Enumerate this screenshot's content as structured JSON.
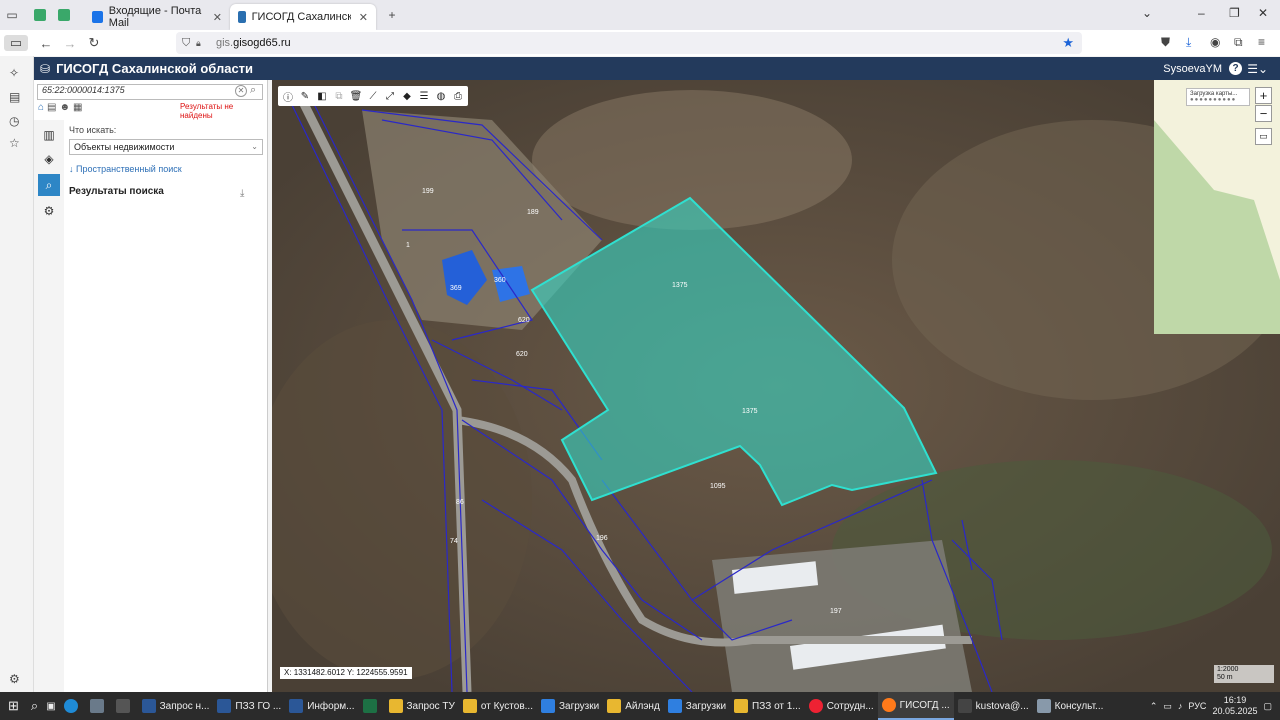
{
  "browser": {
    "tabs": [
      {
        "label": "Входящие - Почта Mail",
        "active": false
      },
      {
        "label": "ГИСОГД Сахалинской области",
        "active": true
      }
    ],
    "url_prefix": "gis.",
    "url_domain": "gisogd65.ru"
  },
  "app": {
    "title": "ГИСОГД Сахалинской области",
    "user": "SysoevaYM",
    "help": "?"
  },
  "panel": {
    "search_value": "65:22:0000014:1375",
    "not_found": "Результаты не найдены",
    "what_label": "Что искать:",
    "object_type": "Объекты недвижимости",
    "spatial_link": "↓ Пространственный поиск",
    "results_title": "Результаты поиска"
  },
  "map": {
    "loading_text": "Загрузка карты...",
    "coords": "X: 1331482.6012   Y: 1224555.9591",
    "scale_ratio": "1:2000",
    "scale_dist": "50 m",
    "parcel_labels": [
      "199",
      "189",
      "369",
      "360",
      "1375",
      "1375",
      "620",
      "620",
      "1095",
      "196",
      "197",
      "86",
      "74",
      "1"
    ]
  },
  "taskbar": {
    "items": [
      "Запрос н...",
      "ПЗЗ ГО ...",
      "Информ...",
      "Запрос ТУ",
      "от Кустов...",
      "Загрузки",
      "Айлэнд",
      "Загрузки",
      "ПЗЗ от 1...",
      "Сотрудн...",
      "ГИСОГД ...",
      "kustova@...",
      "Консульт..."
    ],
    "lang": "РУС",
    "time": "16:19",
    "date": "20.05.2025"
  },
  "colors": {
    "header": "#233a5c",
    "parcel_fill": "#35d6c4",
    "parcel_stroke": "#2fe0d0",
    "boundary": "#2a28c8"
  }
}
